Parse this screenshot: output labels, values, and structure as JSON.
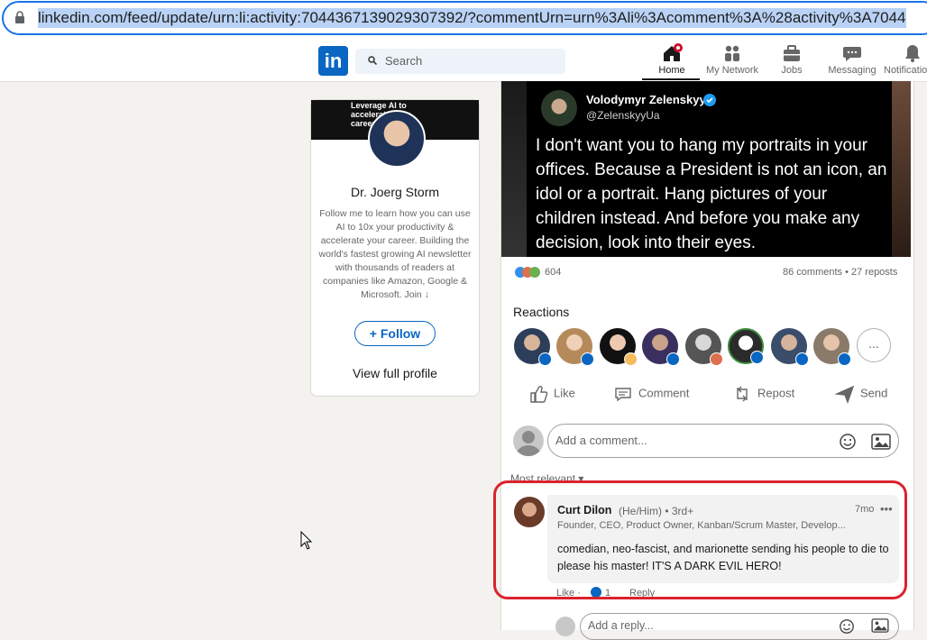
{
  "browser": {
    "url": "linkedin.com/feed/update/urn:li:activity:7044367139029307392/?commentUrn=urn%3Ali%3Acomment%3A%28activity%3A7044"
  },
  "nav": {
    "logo": "in",
    "search_placeholder": "Search",
    "items": [
      {
        "label": "Home",
        "icon": "home-icon"
      },
      {
        "label": "My Network",
        "icon": "network-icon"
      },
      {
        "label": "Jobs",
        "icon": "briefcase-icon"
      },
      {
        "label": "Messaging",
        "icon": "message-icon"
      },
      {
        "label": "Notificatio",
        "icon": "bell-icon"
      }
    ]
  },
  "profile": {
    "banner_text": "Leverage AI to accelerate your career",
    "name": "Dr. Joerg Storm",
    "bio": "Follow me to learn how you can use AI to 10x your productivity & accelerate your career. Building the world's fastest growing AI newsletter with thousands of readers at companies like Amazon, Google & Microsoft. Join ↓",
    "follow_label": "+ Follow",
    "view_profile": "View full profile"
  },
  "post": {
    "tweet": {
      "name": "Volodymyr Zelenskyy",
      "handle": "@ZelenskyyUa",
      "text": "I don't want you to hang my portraits in your offices. Because a President is not an icon, an idol or a portrait. Hang pictures of your children instead. And before you make any decision, look into their eyes."
    },
    "reaction_count": "604",
    "comments_reposts": "86 comments • 27 reposts",
    "reactions_title": "Reactions",
    "more_label": "...",
    "actions": {
      "like": "Like",
      "comment": "Comment",
      "repost": "Repost",
      "send": "Send"
    },
    "comment_placeholder": "Add a comment...",
    "sort_label": "Most relevant ▾"
  },
  "comment": {
    "author": "Curt Dilon",
    "meta": "(He/Him) • 3rd+",
    "headline": "Founder, CEO, Product Owner, Kanban/Scrum Master, Develop...",
    "time": "7mo",
    "menu": "•••",
    "text": "comedian, neo-fascist, and marionette sending his people to die to please his master! IT'S A DARK EVIL HERO!",
    "like": "Like ·",
    "like_count": "1",
    "reply": "Reply",
    "reply_placeholder": "Add a reply..."
  },
  "colors": {
    "accent": "#0a66c2",
    "highlight": "#d9232e"
  }
}
